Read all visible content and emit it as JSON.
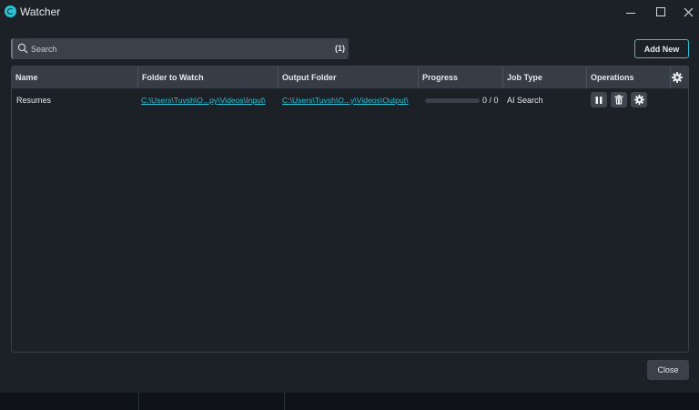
{
  "window": {
    "title": "Watcher",
    "icons": {
      "app": "watcher-logo-icon",
      "minimize": "minimize-icon",
      "maximize": "maximize-icon",
      "close": "close-icon"
    }
  },
  "toolbar": {
    "search_placeholder": "Search",
    "search_value": "",
    "search_count": "(1)",
    "add_new_label": "Add New"
  },
  "table": {
    "columns": [
      "Name",
      "Folder to Watch",
      "Output Folder",
      "Progress",
      "Job Type",
      "Operations"
    ],
    "rows": [
      {
        "name": "Resumes",
        "folder_to_watch": "C:\\Users\\Tuvsh\\O...py\\Videos\\Input\\",
        "output_folder": "C:\\Users\\Tuvsh\\O...y\\Videos\\Output\\",
        "progress_text": "0 / 0",
        "progress_fraction": 0,
        "job_type": "AI Search",
        "operations": [
          "pause-icon",
          "trash-icon",
          "gear-icon"
        ]
      }
    ]
  },
  "footer": {
    "close_label": "Close"
  },
  "colors": {
    "background": "#1c2128",
    "accent": "#2bc3d6",
    "header": "#363d47",
    "control": "#3a414b",
    "statusbar": "#0f1216"
  }
}
